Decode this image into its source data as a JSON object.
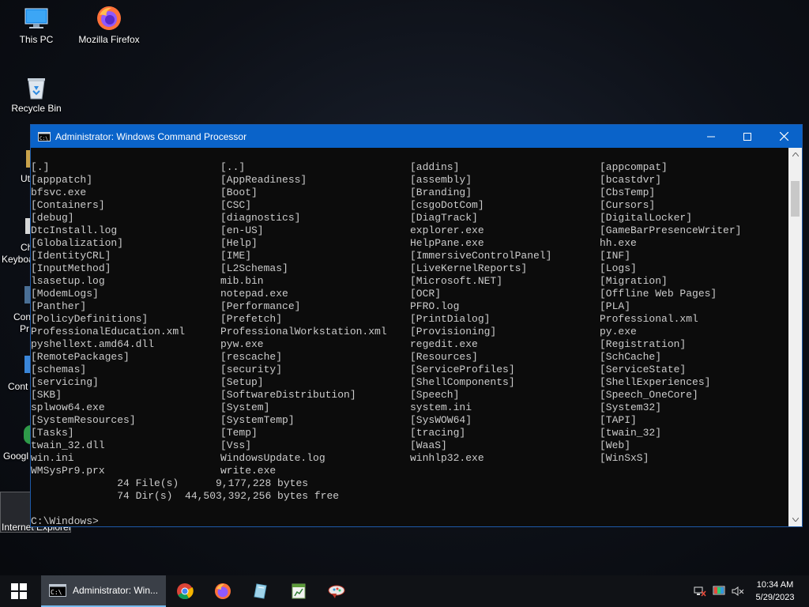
{
  "desktop": {
    "icons": [
      {
        "label": "This PC"
      },
      {
        "label": "Mozilla Firefox"
      },
      {
        "label": "Recycle Bin"
      }
    ],
    "partial_labels": [
      "Ut",
      "Ch",
      "Keyboa",
      "Con",
      "Pr",
      "Cont",
      "Googl",
      "Internet Explorer"
    ]
  },
  "window": {
    "title": "Administrator: Windows Command Processor",
    "rows": [
      [
        "[.]",
        "[..]",
        "[addins]",
        "[appcompat]"
      ],
      [
        "[apppatch]",
        "[AppReadiness]",
        "[assembly]",
        "[bcastdvr]"
      ],
      [
        "bfsvc.exe",
        "[Boot]",
        "[Branding]",
        "[CbsTemp]"
      ],
      [
        "[Containers]",
        "[CSC]",
        "[csgoDotCom]",
        "[Cursors]"
      ],
      [
        "[debug]",
        "[diagnostics]",
        "[DiagTrack]",
        "[DigitalLocker]"
      ],
      [
        "DtcInstall.log",
        "[en-US]",
        "explorer.exe",
        "[GameBarPresenceWriter]"
      ],
      [
        "[Globalization]",
        "[Help]",
        "HelpPane.exe",
        "hh.exe"
      ],
      [
        "[IdentityCRL]",
        "[IME]",
        "[ImmersiveControlPanel]",
        "[INF]"
      ],
      [
        "[InputMethod]",
        "[L2Schemas]",
        "[LiveKernelReports]",
        "[Logs]"
      ],
      [
        "lsasetup.log",
        "mib.bin",
        "[Microsoft.NET]",
        "[Migration]"
      ],
      [
        "[ModemLogs]",
        "notepad.exe",
        "[OCR]",
        "[Offline Web Pages]"
      ],
      [
        "[Panther]",
        "[Performance]",
        "PFRO.log",
        "[PLA]"
      ],
      [
        "[PolicyDefinitions]",
        "[Prefetch]",
        "[PrintDialog]",
        "Professional.xml"
      ],
      [
        "ProfessionalEducation.xml",
        "ProfessionalWorkstation.xml",
        "[Provisioning]",
        "py.exe"
      ],
      [
        "pyshellext.amd64.dll",
        "pyw.exe",
        "regedit.exe",
        "[Registration]"
      ],
      [
        "[RemotePackages]",
        "[rescache]",
        "[Resources]",
        "[SchCache]"
      ],
      [
        "[schemas]",
        "[security]",
        "[ServiceProfiles]",
        "[ServiceState]"
      ],
      [
        "[servicing]",
        "[Setup]",
        "[ShellComponents]",
        "[ShellExperiences]"
      ],
      [
        "[SKB]",
        "[SoftwareDistribution]",
        "[Speech]",
        "[Speech_OneCore]"
      ],
      [
        "splwow64.exe",
        "[System]",
        "system.ini",
        "[System32]"
      ],
      [
        "[SystemResources]",
        "[SystemTemp]",
        "[SysWOW64]",
        "[TAPI]"
      ],
      [
        "[Tasks]",
        "[Temp]",
        "[tracing]",
        "[twain_32]"
      ],
      [
        "twain_32.dll",
        "[Vss]",
        "[WaaS]",
        "[Web]"
      ],
      [
        "win.ini",
        "WindowsUpdate.log",
        "winhlp32.exe",
        "[WinSxS]"
      ],
      [
        "WMSysPr9.prx",
        "write.exe",
        "",
        ""
      ]
    ],
    "summary_files": "              24 File(s)      9,177,228 bytes",
    "summary_dirs": "              74 Dir(s)  44,503,392,256 bytes free",
    "prompt": "C:\\Windows>"
  },
  "taskbar": {
    "active_task_label": "Administrator: Win...",
    "clock_time": "10:34 AM",
    "clock_date": "5/29/2023"
  },
  "colors": {
    "titlebar": "#0a63c9",
    "console_bg": "#0c0c0c",
    "console_text": "#cccccc",
    "taskbar": "#101216"
  }
}
